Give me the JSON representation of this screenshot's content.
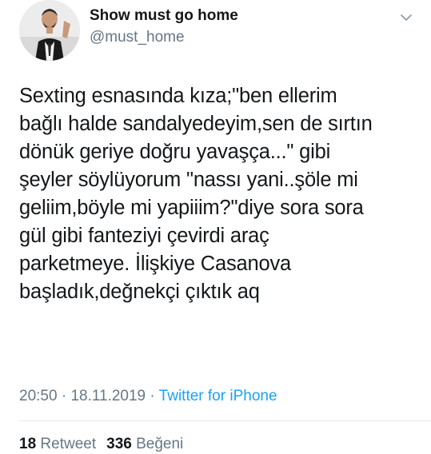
{
  "author": {
    "display_name": "Show must go home",
    "handle": "@must_home"
  },
  "tweet": {
    "text": "Sexting esnasında kıza;\"ben ellerim\nbağlı halde sandalyedeyim,sen de sırtın\ndönük geriye doğru yavaşça...\" gibi\nşeyler söylüyorum \"nassı yani..şöle mi\ngeliim,böyle mi yapiiim?\"diye sora sora\ngül gibi fanteziyi çevirdi araç\nparketmeye. İlişkiye Casanova\nbaşladık,değnekçi çıktık aq",
    "time": "20:50",
    "separator": "·",
    "date": "18.11.2019",
    "source": "Twitter for iPhone"
  },
  "stats": {
    "retweet_count": "18",
    "retweet_label": "Retweet",
    "like_count": "336",
    "like_label": "Beğeni"
  },
  "icons": {
    "menu": "chevron-down-icon"
  },
  "colors": {
    "text": "#14171a",
    "secondary": "#657786",
    "link": "#1da1f2",
    "divider": "#e1e8ed"
  }
}
